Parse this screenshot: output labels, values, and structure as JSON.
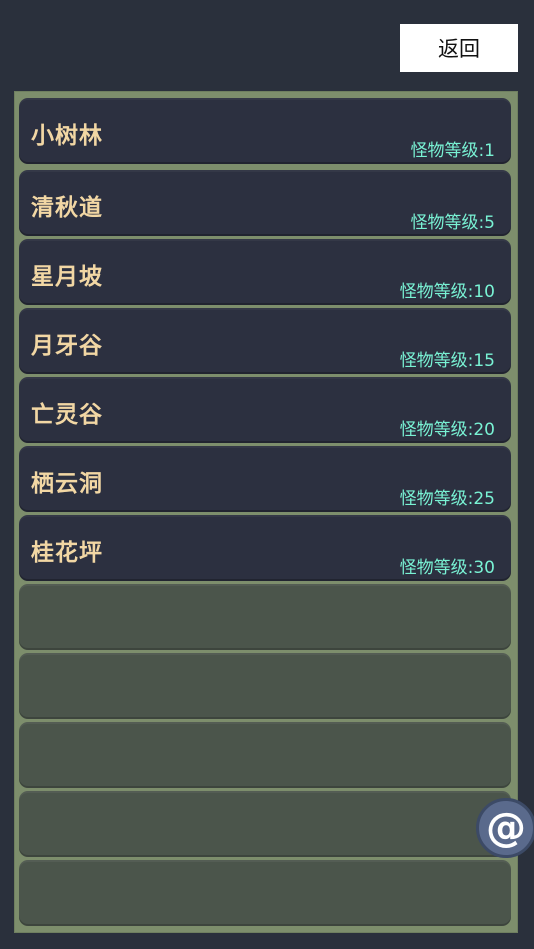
{
  "header": {
    "back_label": "返回"
  },
  "locations": [
    {
      "name": "小树林",
      "level_label": "怪物等级:1"
    },
    {
      "name": "清秋道",
      "level_label": "怪物等级:5"
    },
    {
      "name": "星月坡",
      "level_label": "怪物等级:10"
    },
    {
      "name": "月牙谷",
      "level_label": "怪物等级:15"
    },
    {
      "name": "亡灵谷",
      "level_label": "怪物等级:20"
    },
    {
      "name": "栖云洞",
      "level_label": "怪物等级:25"
    },
    {
      "name": "桂花坪",
      "level_label": "怪物等级:30"
    }
  ],
  "empty_slot_count": 5,
  "chat_button": {
    "icon": "at-icon",
    "glyph": "@"
  },
  "colors": {
    "background": "#2a303c",
    "panel": "#7d8e6c",
    "slot_filled": "#2c3040",
    "slot_empty": "#4b554b",
    "name_text": "#f2d7a4",
    "level_text": "#79f2d4"
  }
}
